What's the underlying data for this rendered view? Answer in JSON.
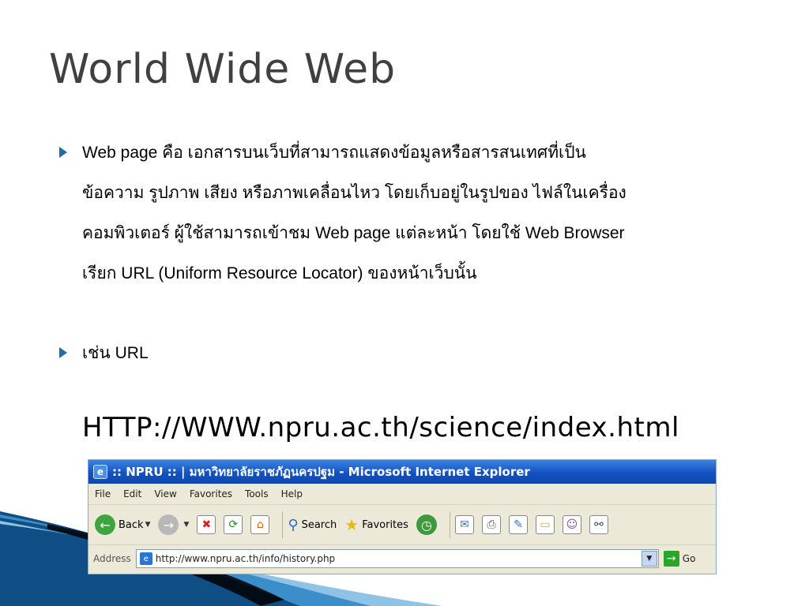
{
  "title": "World Wide Web",
  "bullets": [
    {
      "lines": [
        "Web page คือ เอกสารบนเว็บที่สามารถแสดงข้อมูลหรือสารสนเทศที่เป็น",
        "ข้อความ รูปภาพ เสียง หรือภาพเคลื่อนไหว โดยเก็บอยู่ในรูปของ ไฟล์ในเครื่อง",
        "คอมพิวเตอร์ ผู้ใช้สามารถเข้าชม Web page แต่ละหน้า โดยใช้ Web Browser",
        "เรียก URL (Uniform Resource Locator) ของหน้าเว็บนั้น"
      ]
    },
    {
      "lines": [
        "เช่น URL"
      ]
    }
  ],
  "url_example": "HTTP://WWW.npru.ac.th/science/index.html",
  "browser": {
    "window_title": ":: NPRU :: | มหาวิทยาลัยราชภัฏนครปฐม - Microsoft Internet Explorer",
    "menu": [
      "File",
      "Edit",
      "View",
      "Favorites",
      "Tools",
      "Help"
    ],
    "toolbar": {
      "back": "Back",
      "search": "Search",
      "favorites": "Favorites"
    },
    "address_label": "Address",
    "address_value": "http://www.npru.ac.th/info/history.php",
    "go_label": "Go"
  },
  "colors": {
    "title": "#404040",
    "bullet_arrow": "#1e6fa8",
    "swoosh": "#1b5e96"
  }
}
